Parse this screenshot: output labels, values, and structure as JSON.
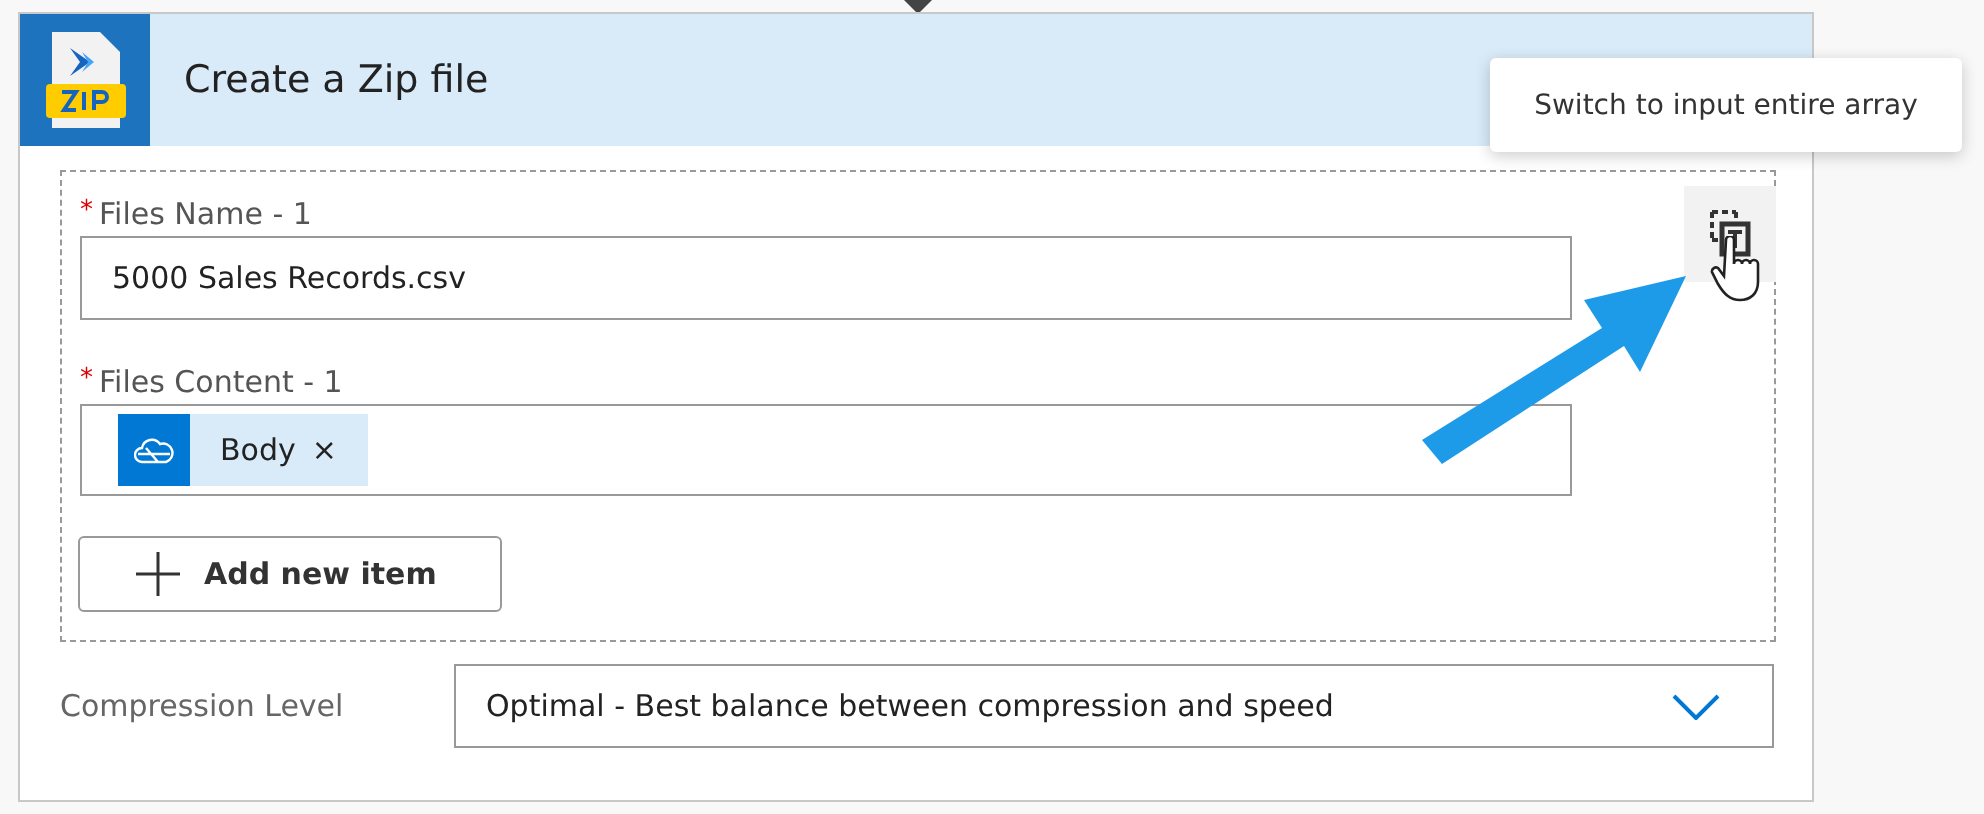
{
  "action": {
    "title": "Create a Zip file"
  },
  "array_items": [
    {
      "label": "Files Name - 1",
      "required": true,
      "required_mark": "*",
      "kind": "text",
      "value": "5000 Sales Records.csv"
    },
    {
      "label": "Files Content - 1",
      "required": true,
      "required_mark": "*",
      "kind": "token",
      "token": {
        "label": "Body",
        "remove": "×"
      }
    }
  ],
  "add_button": "Add new item",
  "compression": {
    "label": "Compression Level",
    "value": "Optimal - Best balance between compression and speed"
  },
  "tooltip": "Switch to input entire array"
}
